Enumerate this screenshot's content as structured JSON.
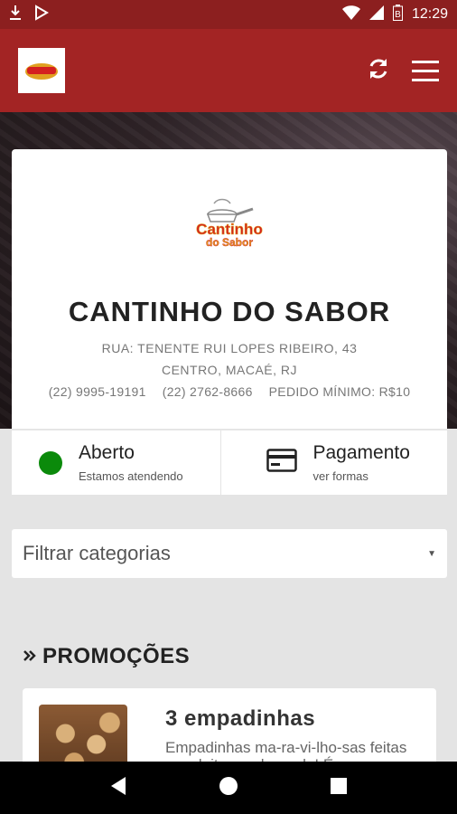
{
  "status_bar": {
    "time": "12:29"
  },
  "app_bar": {
    "logo_text": "Cantinho do Sabor"
  },
  "restaurant": {
    "logo_text_line1": "Cantinho",
    "logo_text_line2": "do Sabor",
    "name": "CANTINHO DO SABOR",
    "address_line1": "RUA: TENENTE RUI LOPES RIBEIRO, 43",
    "address_line2": "CENTRO, MACAÉ, RJ",
    "phone1": "(22) 9995-19191",
    "phone2": "(22) 2762-8666",
    "min_order": "PEDIDO MÍNIMO: R$10"
  },
  "info": {
    "status_title": "Aberto",
    "status_sub": "Estamos atendendo",
    "status_color": "#0b8a0b",
    "payment_title": "Pagamento",
    "payment_sub": "ver formas"
  },
  "filter": {
    "label": "Filtrar categorias"
  },
  "promotions": {
    "section_title": "PROMOÇÕES",
    "items": [
      {
        "title": "3 empadinhas",
        "description": "Empadinhas ma-ra-vi-lho-sas feitas com leite condensado! É"
      }
    ]
  },
  "colors": {
    "brand_dark": "#8c1f1f",
    "brand": "#a32424"
  }
}
